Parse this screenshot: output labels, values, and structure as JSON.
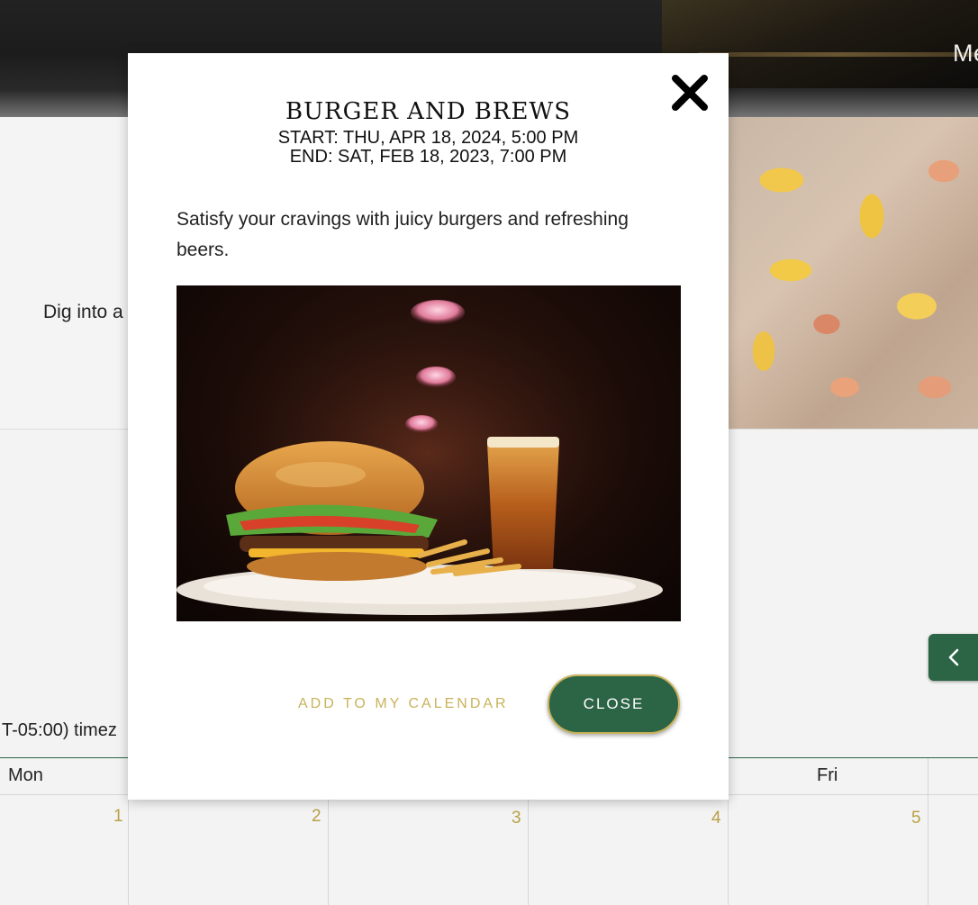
{
  "page": {
    "nav_menu_partial": "Me",
    "hero_text_partial": "Dig into a",
    "timezone_partial": "T-05:00) timez"
  },
  "calendar": {
    "weekdays": [
      "Mon",
      "Fri"
    ],
    "dates": [
      "1",
      "2",
      "3",
      "4",
      "5"
    ]
  },
  "modal": {
    "title": "Burger and Brews",
    "start": "START: THU, APR 18, 2024, 5:00 PM",
    "end": "END: SAT, FEB 18, 2023, 7:00 PM",
    "description": "Satisfy your cravings with juicy burgers and refreshing beers.",
    "add_to_calendar_label": "ADD TO MY CALENDAR",
    "close_label": "CLOSE"
  },
  "colors": {
    "brand_green": "#2c6446",
    "accent_gold": "#c9b25a"
  },
  "icons": {
    "close": "close-icon",
    "prev": "chevron-left-icon"
  }
}
